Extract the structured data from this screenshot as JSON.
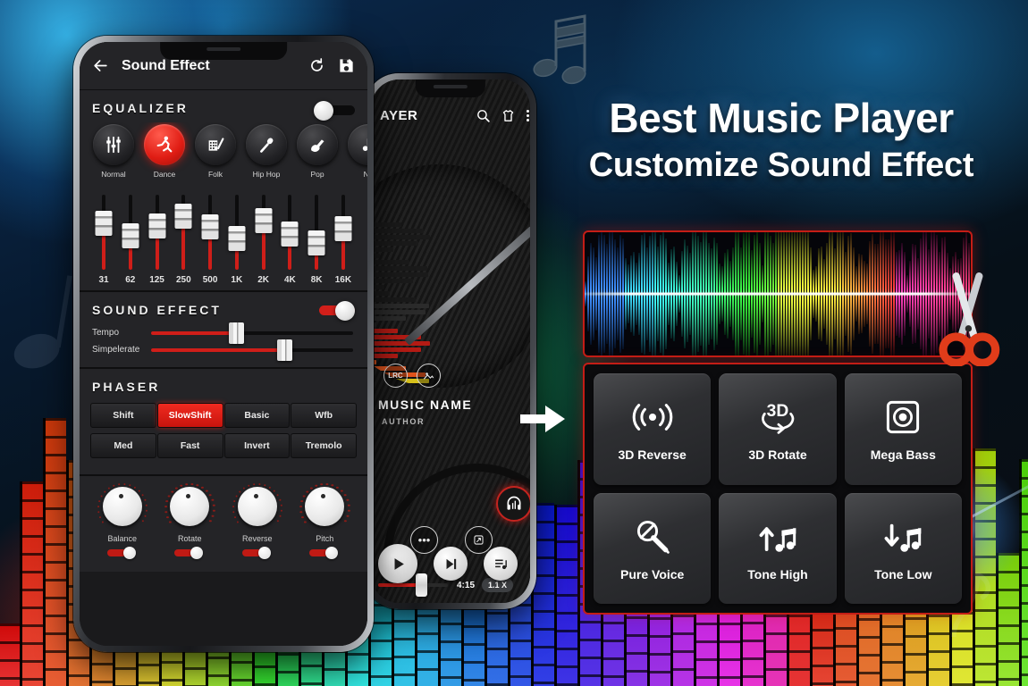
{
  "promo": {
    "headline_1": "Best Music Player",
    "headline_2": "Customize Sound Effect",
    "note_icon": "music-note-icon",
    "arrow_icon": "arrow-right-icon",
    "scissors_icon": "scissors-icon",
    "accent_red": "#c41d16",
    "accent_blue": "#1f8fd6"
  },
  "sound_effect_screen": {
    "header": {
      "back_icon": "back-arrow-icon",
      "title": "Sound Effect",
      "reset_icon": "refresh-icon",
      "save_icon": "save-floppy-icon"
    },
    "equalizer": {
      "title": "EQUALIZER",
      "enabled": false,
      "presets": [
        {
          "label": "Normal",
          "icon": "equalizer-sliders-icon",
          "active": false
        },
        {
          "label": "Dance",
          "icon": "dancer-icon",
          "active": true
        },
        {
          "label": "Folk",
          "icon": "accordion-icon",
          "active": false
        },
        {
          "label": "Hip Hop",
          "icon": "microphone-icon",
          "active": false
        },
        {
          "label": "Pop",
          "icon": "guitar-icon",
          "active": false
        },
        {
          "label": "No",
          "icon": "note-icon",
          "active": false
        }
      ],
      "bands": [
        {
          "label": "31",
          "value": 62
        },
        {
          "label": "62",
          "value": 45
        },
        {
          "label": "125",
          "value": 58
        },
        {
          "label": "250",
          "value": 72
        },
        {
          "label": "500",
          "value": 57
        },
        {
          "label": "1K",
          "value": 42
        },
        {
          "label": "2K",
          "value": 66
        },
        {
          "label": "4K",
          "value": 48
        },
        {
          "label": "8K",
          "value": 36
        },
        {
          "label": "16K",
          "value": 55
        }
      ]
    },
    "sound_effect": {
      "title": "SOUND EFFECT",
      "enabled": true,
      "sliders": [
        {
          "label": "Tempo",
          "value": 42
        },
        {
          "label": "Simpelerate",
          "value": 66
        }
      ]
    },
    "phaser": {
      "title": "PHASER",
      "rows": [
        [
          {
            "label": "Shift",
            "active": false
          },
          {
            "label": "SlowShift",
            "active": true
          },
          {
            "label": "Basic",
            "active": false
          },
          {
            "label": "Wfb",
            "active": false
          }
        ],
        [
          {
            "label": "Med",
            "active": false
          },
          {
            "label": "Fast",
            "active": false
          },
          {
            "label": "Invert",
            "active": false
          },
          {
            "label": "Tremolo",
            "active": false
          }
        ]
      ]
    },
    "knobs": [
      {
        "label": "Balance",
        "enabled": true
      },
      {
        "label": "Rotate",
        "enabled": true
      },
      {
        "label": "Reverse",
        "enabled": true
      },
      {
        "label": "Pitch",
        "enabled": true
      }
    ]
  },
  "player_screen": {
    "title": "AYER",
    "icons": {
      "search": "search-icon",
      "theme": "theme-shirt-icon",
      "more": "more-vertical-icon"
    },
    "lrc_badge": "LRC",
    "image_badge": "image-icon",
    "track_name": "MUSIC NAME",
    "track_author": "AUTHOR",
    "headphone_icon": "headphone-equalizer-icon",
    "more_button_icon": "more-horizontal-icon",
    "edit_button_icon": "edit-square-icon",
    "progress": 62,
    "duration": "4:15",
    "speed": "1.1 X",
    "transport": {
      "play": "play-icon",
      "next": "next-track-icon",
      "playlist": "playlist-icon"
    }
  },
  "effect_grid": {
    "tiles": [
      {
        "label": "3D Reverse",
        "icon": "signal-waves-icon"
      },
      {
        "label": "3D Rotate",
        "icon": "3d-rotate-icon"
      },
      {
        "label": "Mega Bass",
        "icon": "speaker-square-icon"
      },
      {
        "label": "Pure Voice",
        "icon": "mic-muted-icon"
      },
      {
        "label": "Tone High",
        "icon": "arrow-up-note-icon"
      },
      {
        "label": "Tone Low",
        "icon": "arrow-down-note-icon"
      }
    ]
  }
}
